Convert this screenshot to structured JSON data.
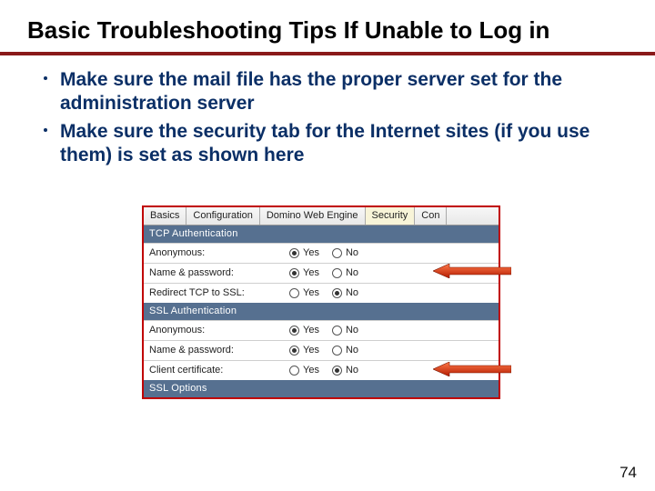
{
  "title": "Basic Troubleshooting Tips If Unable to Log in",
  "bullets": [
    "Make sure the mail file has the proper server set for the administration server",
    "Make sure the security tab for the Internet sites (if you use them) is set as shown here"
  ],
  "tabs": {
    "items": [
      "Basics",
      "Configuration",
      "Domino Web Engine",
      "Security",
      "Con"
    ],
    "active_index": 3
  },
  "sections": [
    {
      "header": "TCP Authentication",
      "rows": [
        {
          "label": "Anonymous:",
          "selected": "Yes"
        },
        {
          "label": "Name & password:",
          "selected": "Yes"
        },
        {
          "label": "Redirect TCP to SSL:",
          "selected": "No"
        }
      ]
    },
    {
      "header": "SSL Authentication",
      "rows": [
        {
          "label": "Anonymous:",
          "selected": "Yes"
        },
        {
          "label": "Name & password:",
          "selected": "Yes"
        },
        {
          "label": "Client certificate:",
          "selected": "No"
        }
      ]
    },
    {
      "header": "SSL Options",
      "rows": []
    }
  ],
  "options": {
    "yes": "Yes",
    "no": "No"
  },
  "page_number": "74"
}
